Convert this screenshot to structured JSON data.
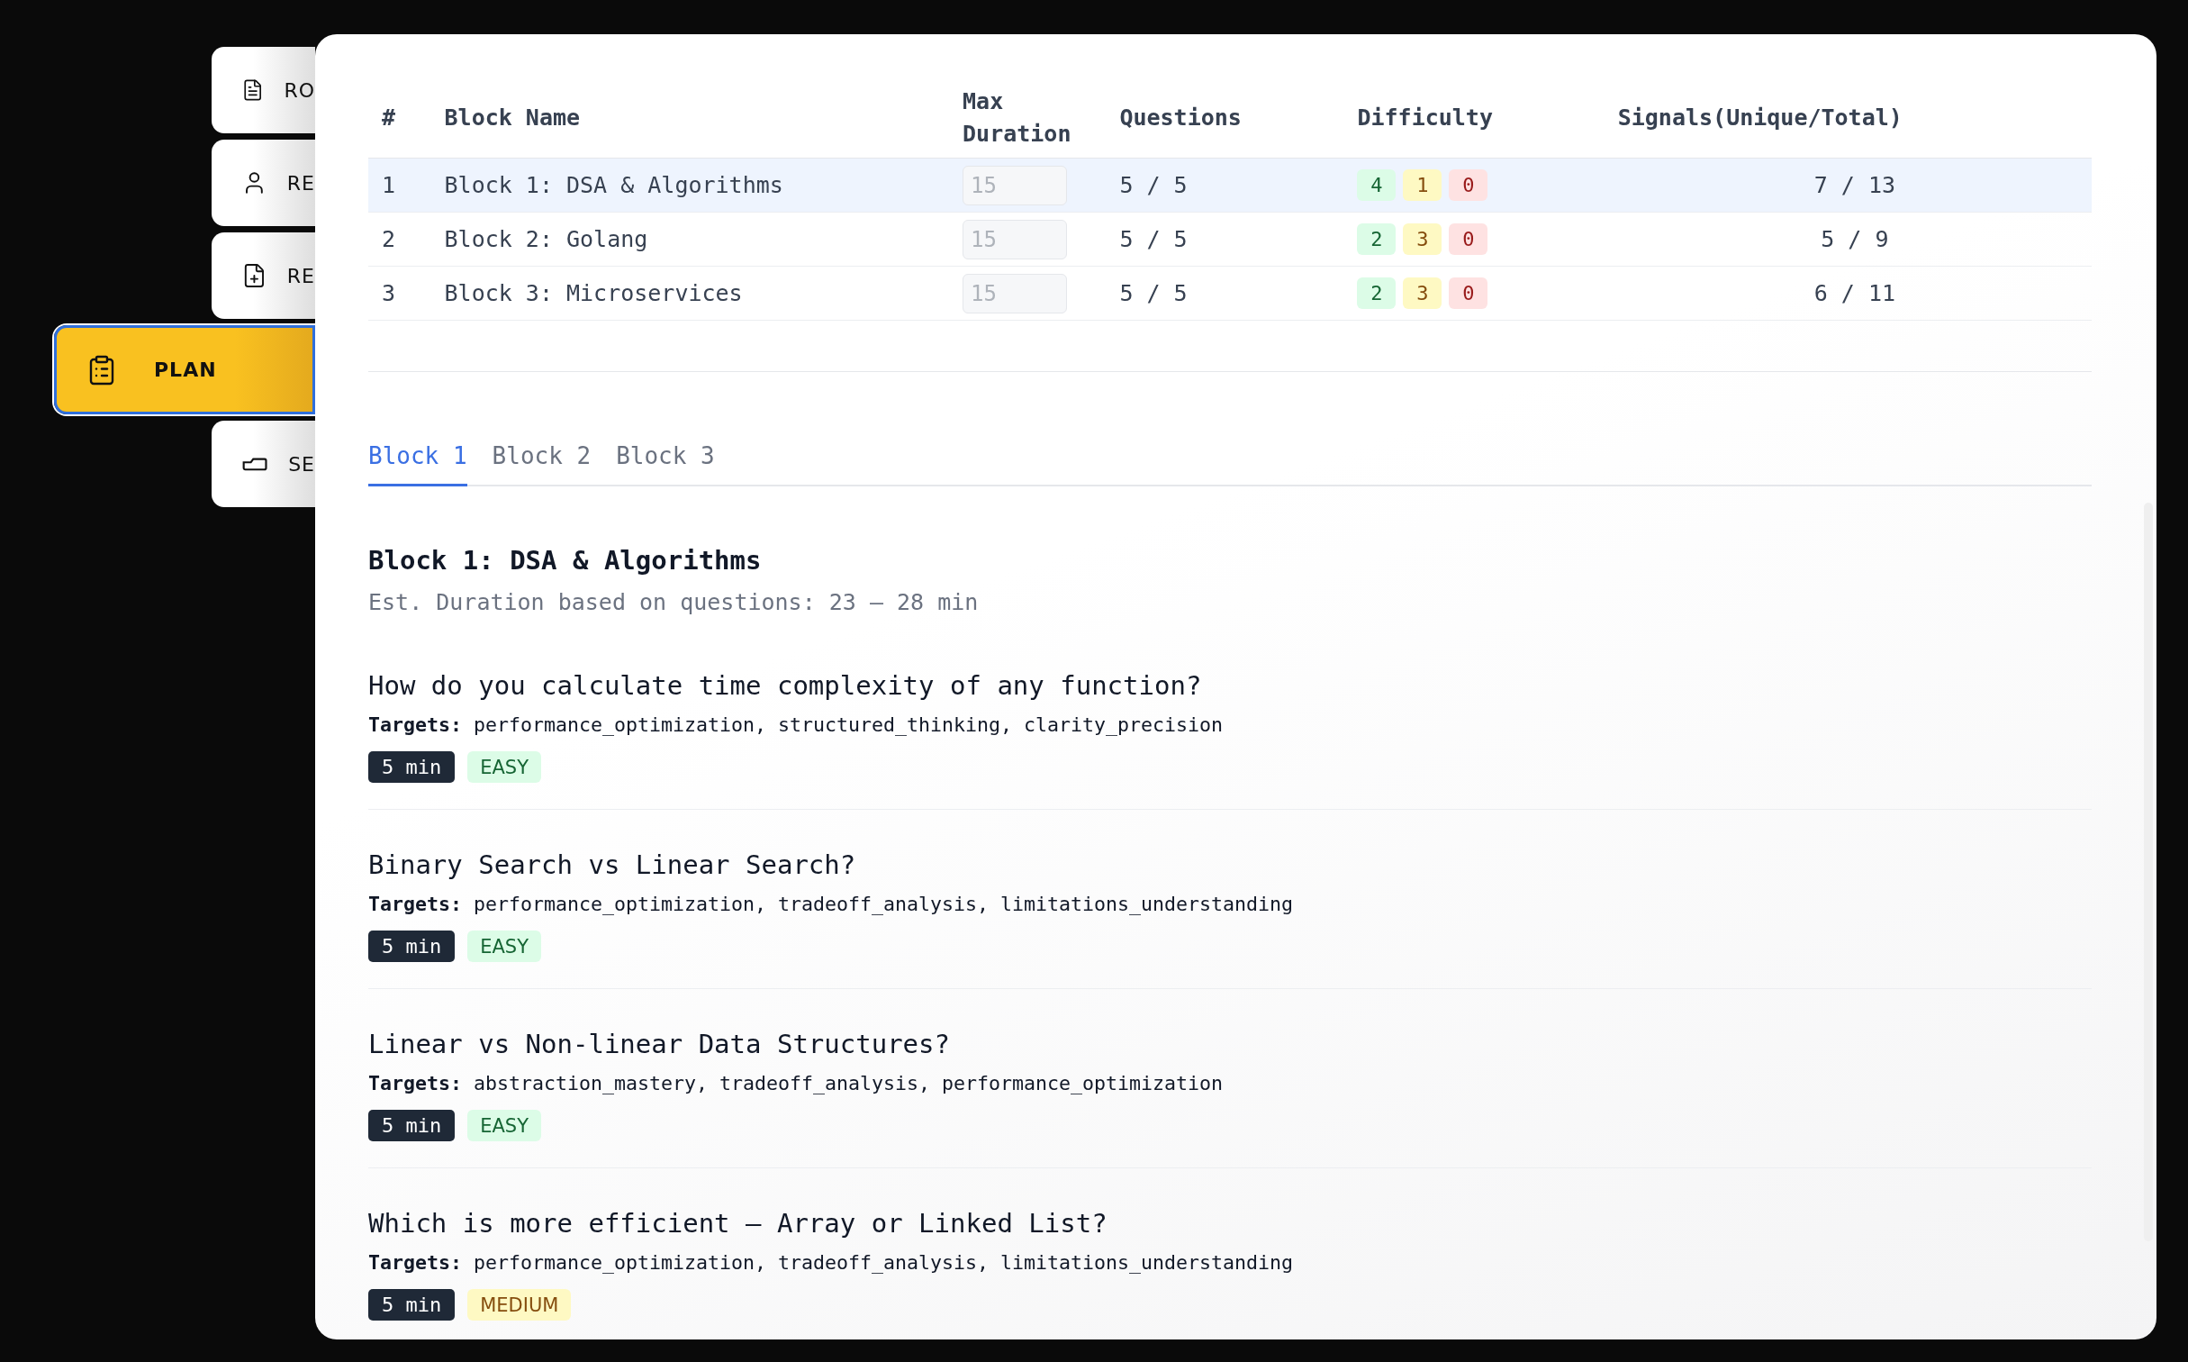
{
  "sidebar": {
    "items": [
      {
        "label": "RO",
        "selected": false
      },
      {
        "label": "RE",
        "selected": false
      },
      {
        "label": "RE",
        "selected": false
      },
      {
        "label": "PLAN",
        "selected": true
      },
      {
        "label": "SE",
        "selected": false
      }
    ]
  },
  "summary_table": {
    "columns": [
      "#",
      "Block Name",
      "Max Duration",
      "Questions",
      "Difficulty",
      "Signals(Unique/Total)"
    ],
    "rows": [
      {
        "number": "1",
        "name": "Block 1: DSA & Algorithms",
        "max_duration": {
          "placeholder": "15"
        },
        "questions": "5 / 5",
        "difficulty": [
          {
            "kind": "easy",
            "count": "4"
          },
          {
            "kind": "medium",
            "count": "1"
          },
          {
            "kind": "hard",
            "count": "0"
          }
        ],
        "signals": "7 / 13",
        "selected": true
      },
      {
        "number": "2",
        "name": "Block 2: Golang",
        "max_duration": {
          "placeholder": "15"
        },
        "questions": "5 / 5",
        "difficulty": [
          {
            "kind": "easy",
            "count": "2"
          },
          {
            "kind": "medium",
            "count": "3"
          },
          {
            "kind": "hard",
            "count": "0"
          }
        ],
        "signals": "5 / 9",
        "selected": false
      },
      {
        "number": "3",
        "name": "Block 3: Microservices",
        "max_duration": {
          "placeholder": "15"
        },
        "questions": "5 / 5",
        "difficulty": [
          {
            "kind": "easy",
            "count": "2"
          },
          {
            "kind": "medium",
            "count": "3"
          },
          {
            "kind": "hard",
            "count": "0"
          }
        ],
        "signals": "6 / 11",
        "selected": false
      }
    ]
  },
  "tabs": [
    {
      "label": "Block 1",
      "selected": true
    },
    {
      "label": "Block 2",
      "selected": false
    },
    {
      "label": "Block 3",
      "selected": false
    }
  ],
  "block": {
    "title": "Block 1: DSA & Algorithms",
    "subtitle": "Est. Duration based on questions: 23 – 28 min",
    "questions": [
      {
        "text": "How do you calculate time complexity of any function?",
        "targets": "**Targets:** performance_optimization, structured_thinking, clarity_precision",
        "duration": "5 min",
        "difficulty": {
          "kind": "easy",
          "label": "EASY"
        }
      },
      {
        "text": "Binary Search vs Linear Search?",
        "targets": "**Targets:** performance_optimization, tradeoff_analysis, limitations_understanding",
        "duration": "5 min",
        "difficulty": {
          "kind": "easy",
          "label": "EASY"
        }
      },
      {
        "text": "Linear vs Non-linear Data Structures?",
        "targets": "**Targets:** abstraction_mastery, tradeoff_analysis, performance_optimization",
        "duration": "5 min",
        "difficulty": {
          "kind": "easy",
          "label": "EASY"
        }
      },
      {
        "text": "Which is more efficient – Array or Linked List?",
        "targets": "**Targets:** performance_optimization, tradeoff_analysis, limitations_understanding",
        "duration": "5 min",
        "difficulty": {
          "kind": "medium",
          "label": "MEDIUM"
        }
      }
    ]
  }
}
